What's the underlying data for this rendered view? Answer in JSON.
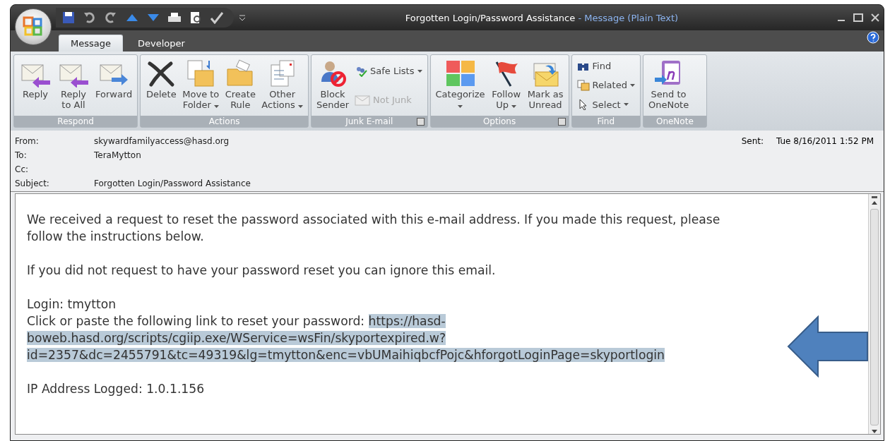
{
  "window": {
    "title": "Forgotten Login/Password Assistance",
    "title_suffix": "- Message (Plain Text)"
  },
  "tabs": [
    {
      "label": "Message",
      "selected": true
    },
    {
      "label": "Developer",
      "selected": false
    }
  ],
  "ribbon": [
    {
      "label": "Respond",
      "launcher": false,
      "buttons": [
        {
          "kind": "large",
          "label_lines": [
            "Reply"
          ],
          "dropdown": false,
          "disabled": false
        },
        {
          "kind": "large",
          "label_lines": [
            "Reply",
            "to All"
          ],
          "dropdown": false,
          "disabled": false
        },
        {
          "kind": "large",
          "label_lines": [
            "Forward"
          ],
          "dropdown": false,
          "disabled": false
        }
      ]
    },
    {
      "label": "Actions",
      "launcher": false,
      "buttons": [
        {
          "kind": "large",
          "label_lines": [
            "Delete"
          ],
          "dropdown": false,
          "disabled": false
        },
        {
          "kind": "large",
          "label_lines": [
            "Move to",
            "Folder"
          ],
          "dropdown": true,
          "disabled": false
        },
        {
          "kind": "large",
          "label_lines": [
            "Create",
            "Rule"
          ],
          "dropdown": false,
          "disabled": false
        },
        {
          "kind": "large",
          "label_lines": [
            "Other",
            "Actions"
          ],
          "dropdown": true,
          "disabled": false
        }
      ]
    },
    {
      "label": "Junk E-mail",
      "launcher": true,
      "buttons": [
        {
          "kind": "large",
          "label_lines": [
            "Block",
            "Sender"
          ],
          "dropdown": false,
          "disabled": false
        },
        {
          "kind": "small",
          "label_lines": [
            "Safe Lists"
          ],
          "dropdown": true,
          "disabled": false
        },
        {
          "kind": "small",
          "label_lines": [
            "Not Junk"
          ],
          "dropdown": false,
          "disabled": true
        }
      ]
    },
    {
      "label": "Options",
      "launcher": true,
      "buttons": [
        {
          "kind": "large",
          "label_lines": [
            "Categorize"
          ],
          "dropdown": true,
          "disabled": false
        },
        {
          "kind": "large",
          "label_lines": [
            "Follow",
            "Up"
          ],
          "dropdown": true,
          "disabled": false
        },
        {
          "kind": "large",
          "label_lines": [
            "Mark as",
            "Unread"
          ],
          "dropdown": false,
          "disabled": false
        }
      ]
    },
    {
      "label": "Find",
      "launcher": false,
      "buttons": [
        {
          "kind": "small",
          "label_lines": [
            "Find"
          ],
          "dropdown": false,
          "disabled": false
        },
        {
          "kind": "small",
          "label_lines": [
            "Related"
          ],
          "dropdown": true,
          "disabled": false
        },
        {
          "kind": "small",
          "label_lines": [
            "Select"
          ],
          "dropdown": true,
          "disabled": false
        }
      ]
    },
    {
      "label": "OneNote",
      "launcher": false,
      "buttons": [
        {
          "kind": "large",
          "label_lines": [
            "Send to",
            "OneNote"
          ],
          "dropdown": false,
          "disabled": false
        }
      ]
    }
  ],
  "header": {
    "fields": [
      {
        "label": "From:",
        "value": "skywardfamilyaccess@hasd.org"
      },
      {
        "label": "To:",
        "value": "TeraMytton"
      },
      {
        "label": "Cc:"
      },
      {
        "label": "Subject:",
        "value": "Forgotten Login/Password Assistance"
      }
    ],
    "sent": {
      "label": "Sent:",
      "value": "Tue 8/16/2011 1:52 PM"
    }
  },
  "body": {
    "paragraphs": [
      {
        "lines": [
          {
            "text": "We received a request to reset the password associated with this e-mail address. If you made this request, please follow the instructions below."
          }
        ]
      },
      {
        "lines": [
          {
            "text": "If you did not request to have your password reset you can ignore this email."
          }
        ]
      },
      {
        "lines": [
          {
            "text": "Login: tmytton"
          },
          {
            "text": "Click or paste the following link to reset your password:",
            "selection": {
              "text": "https://hasd-boweb.hasd.org/scripts/cgiip.exe/WService=wsFin/skyportexpired.w?id=2357&dc=2455791&tc=49319&lg=tmytton&enc=vbUMaihiqbcfPojc&hforgotLoginPage=skyportlogin",
              "selected": true
            }
          }
        ]
      },
      {
        "lines": [
          {
            "text": "IP Address Logged: 1.0.1.156"
          }
        ]
      }
    ]
  }
}
